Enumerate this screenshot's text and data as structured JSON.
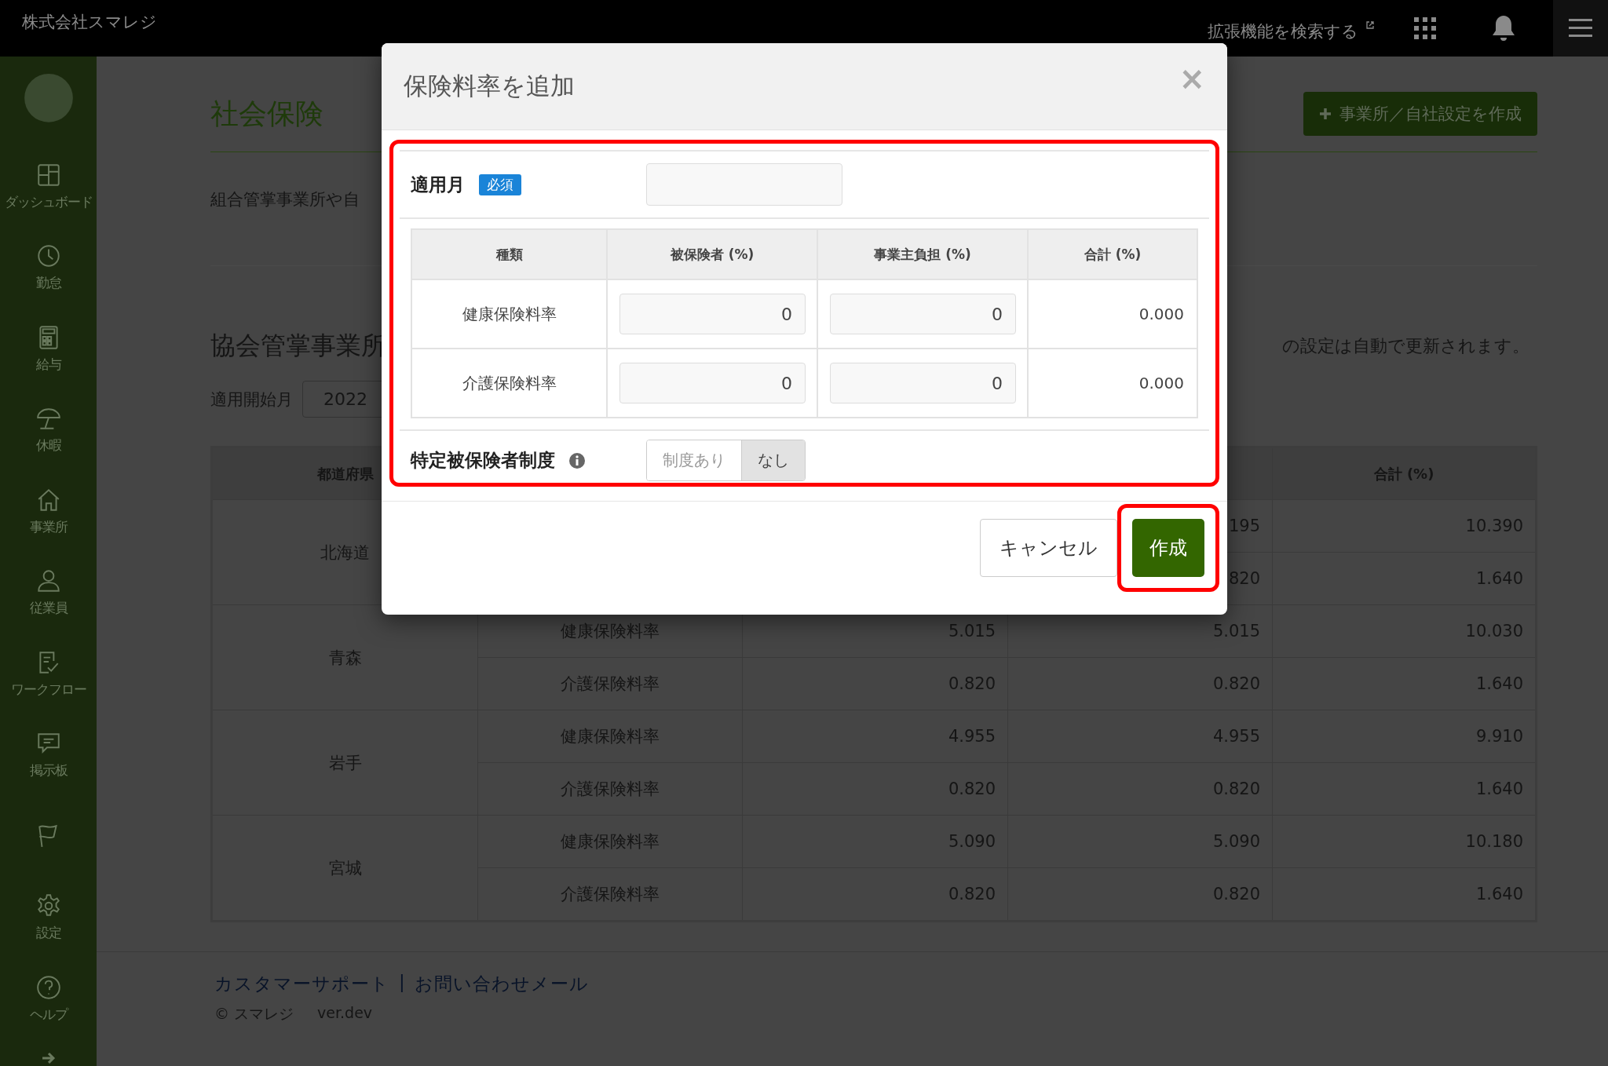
{
  "top_bar": {
    "company": "株式会社スマレジ",
    "extension_search": "拡張機能を検索する"
  },
  "sidebar": {
    "items": [
      {
        "kind": "labeled",
        "label": "ダッシュボード"
      },
      {
        "kind": "labeled",
        "label": "勤怠"
      },
      {
        "kind": "labeled",
        "label": "給与"
      },
      {
        "kind": "labeled",
        "label": "休暇"
      },
      {
        "kind": "labeled",
        "label": "事業所"
      },
      {
        "kind": "labeled",
        "label": "従業員"
      },
      {
        "kind": "labeled",
        "label": "ワークフロー"
      },
      {
        "kind": "labeled",
        "label": "掲示板"
      },
      {
        "kind": "icon_only"
      },
      {
        "kind": "labeled",
        "label": "設定"
      },
      {
        "kind": "labeled",
        "label": "ヘルプ"
      }
    ]
  },
  "page": {
    "title": "社会保険",
    "create_button": "事業所／自社設定を作成",
    "description": "組合管掌事業所や自",
    "section_title": "協会管掌事業所",
    "start_month_label": "適用開始月",
    "start_month_value": "2022",
    "note": "の設定は自動で更新されます。",
    "table": {
      "prefecture_header": "都道府県",
      "total_header": "合計 (%)",
      "groups": [
        {
          "prefecture": "北海道",
          "rows": [
            {
              "employer": "195",
              "total": "10.390"
            },
            {
              "employer": "820",
              "total": "1.640"
            }
          ]
        },
        {
          "prefecture": "青森",
          "rows": [
            {
              "type": "健康保険料率",
              "insured": "5.015",
              "employer": "5.015",
              "total": "10.030"
            },
            {
              "type": "介護保険料率",
              "insured": "0.820",
              "employer": "0.820",
              "total": "1.640"
            }
          ]
        },
        {
          "prefecture": "岩手",
          "rows": [
            {
              "type": "健康保険料率",
              "insured": "4.955",
              "employer": "4.955",
              "total": "9.910"
            },
            {
              "type": "介護保険料率",
              "insured": "0.820",
              "employer": "0.820",
              "total": "1.640"
            }
          ]
        },
        {
          "prefecture": "宮城",
          "rows": [
            {
              "type": "健康保険料率",
              "insured": "5.090",
              "employer": "5.090",
              "total": "10.180"
            },
            {
              "type": "介護保険料率",
              "insured": "0.820",
              "employer": "0.820",
              "total": "1.640"
            }
          ]
        }
      ]
    }
  },
  "footer": {
    "links": [
      "カスタマーサポート",
      "お問い合わせメール"
    ],
    "separator": "|",
    "copyright": "© スマレジ",
    "version": "ver.dev"
  },
  "modal": {
    "title": "保険料率を追加",
    "close": "×",
    "month": {
      "label": "適用月",
      "badge": "必須"
    },
    "rate_table": {
      "columns": [
        "種類",
        "被保険者 (%)",
        "事業主負担 (%)",
        "合計 (%)"
      ],
      "rows": [
        {
          "type": "健康保険料率",
          "insured": "0",
          "employer": "0",
          "total": "0.000"
        },
        {
          "type": "介護保険料率",
          "insured": "0",
          "employer": "0",
          "total": "0.000"
        }
      ]
    },
    "special": {
      "label": "特定被保険者制度",
      "options": [
        {
          "label": "制度あり",
          "selected": false
        },
        {
          "label": "なし",
          "selected": true
        }
      ]
    },
    "buttons": {
      "cancel": "キャンセル",
      "create": "作成"
    }
  }
}
